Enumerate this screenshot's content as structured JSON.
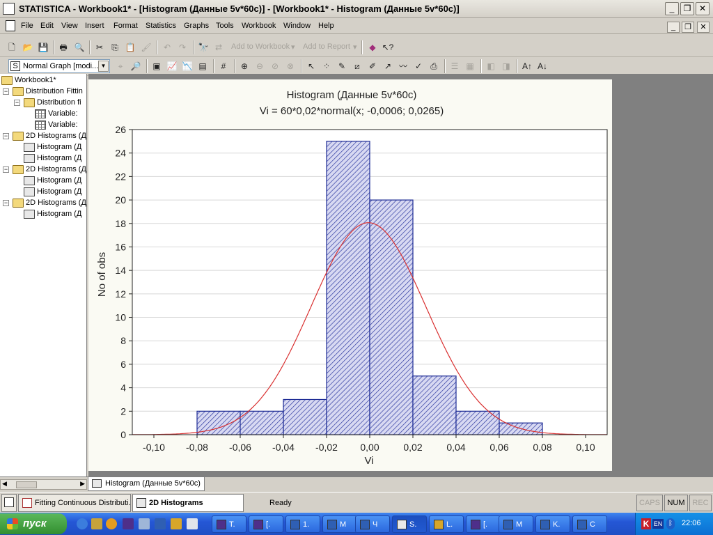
{
  "window": {
    "title": "STATISTICA - Workbook1* - [Histogram (Данные 5v*60c)] - [Workbook1* - Histogram (Данные 5v*60c)]"
  },
  "menu": [
    "File",
    "Edit",
    "View",
    "Insert",
    "Format",
    "Statistics",
    "Graphs",
    "Tools",
    "Workbook",
    "Window",
    "Help"
  ],
  "toolbar": {
    "add_to_workbook": "Add to Workbook",
    "add_to_report": "Add to Report",
    "graph_type": "Normal Graph [modi..."
  },
  "tree": [
    {
      "label": "Workbook1*",
      "icon": "folder-icon",
      "depth": 0
    },
    {
      "label": "Distribution Fittin",
      "icon": "folder-icon",
      "depth": 1
    },
    {
      "label": "Distribution fi",
      "icon": "folder-icon",
      "depth": 2
    },
    {
      "label": "Variable:",
      "icon": "spreadsheet-icon",
      "depth": 3
    },
    {
      "label": "Variable:",
      "icon": "spreadsheet-icon",
      "depth": 3
    },
    {
      "label": "2D Histograms (Д",
      "icon": "folder-icon",
      "depth": 1
    },
    {
      "label": "Histogram (Д",
      "icon": "histogram-icon",
      "depth": 2
    },
    {
      "label": "Histogram (Д",
      "icon": "histogram-icon",
      "depth": 2
    },
    {
      "label": "2D Histograms (Д",
      "icon": "folder-icon",
      "depth": 1
    },
    {
      "label": "Histogram (Д",
      "icon": "histogram-icon",
      "depth": 2
    },
    {
      "label": "Histogram (Д",
      "icon": "histogram-icon",
      "depth": 2
    },
    {
      "label": "2D Histograms (Д",
      "icon": "folder-icon",
      "depth": 1
    },
    {
      "label": "Histogram (Д",
      "icon": "histogram-icon",
      "depth": 2
    }
  ],
  "doc_tab": "Histogram (Данные 5v*60c)",
  "statusbar": {
    "tasks": [
      "Fitting Continuous Distributi...",
      "2D Histograms"
    ],
    "ready": "Ready",
    "caps": "CAPS",
    "num": "NUM",
    "rec": "REC"
  },
  "taskbar": {
    "start": "пуск",
    "tasks": [
      "T.",
      "[.",
      "1.",
      "M",
      "Ч",
      "S.",
      "L.",
      "[.",
      "M",
      "K.",
      "C"
    ],
    "lang": "EN",
    "time": "22:06"
  },
  "colors": {
    "bar_fill": "#c7c9ee",
    "bar_stroke": "#1c2a94",
    "curve": "#d93030",
    "plot_bg": "#ffffff"
  },
  "chart_data": {
    "type": "bar",
    "title": "Histogram (Данные 5v*60c)",
    "subtitle": "Vi = 60*0,02*normal(x; -0,0006; 0,0265)",
    "xlabel": "Vi",
    "ylabel": "No of obs",
    "xlim": [
      -0.11,
      0.11
    ],
    "ylim": [
      0,
      26
    ],
    "x_ticks": [
      "-0,10",
      "-0,08",
      "-0,06",
      "-0,04",
      "-0,02",
      "0,00",
      "0,02",
      "0,04",
      "0,06",
      "0,08",
      "0,10"
    ],
    "y_ticks": [
      "0",
      "2",
      "4",
      "6",
      "8",
      "10",
      "12",
      "14",
      "16",
      "18",
      "20",
      "22",
      "24",
      "26"
    ],
    "grid": true,
    "bins": [
      {
        "from": -0.08,
        "to": -0.06,
        "count": 2
      },
      {
        "from": -0.06,
        "to": -0.04,
        "count": 2
      },
      {
        "from": -0.04,
        "to": -0.02,
        "count": 3
      },
      {
        "from": -0.02,
        "to": 0.0,
        "count": 25
      },
      {
        "from": 0.0,
        "to": 0.02,
        "count": 20
      },
      {
        "from": 0.02,
        "to": 0.04,
        "count": 5
      },
      {
        "from": 0.04,
        "to": 0.06,
        "count": 2
      },
      {
        "from": 0.06,
        "to": 0.08,
        "count": 1
      }
    ],
    "curve": {
      "n": 60,
      "bin_width": 0.02,
      "mean": -0.0006,
      "sd": 0.0265
    }
  }
}
